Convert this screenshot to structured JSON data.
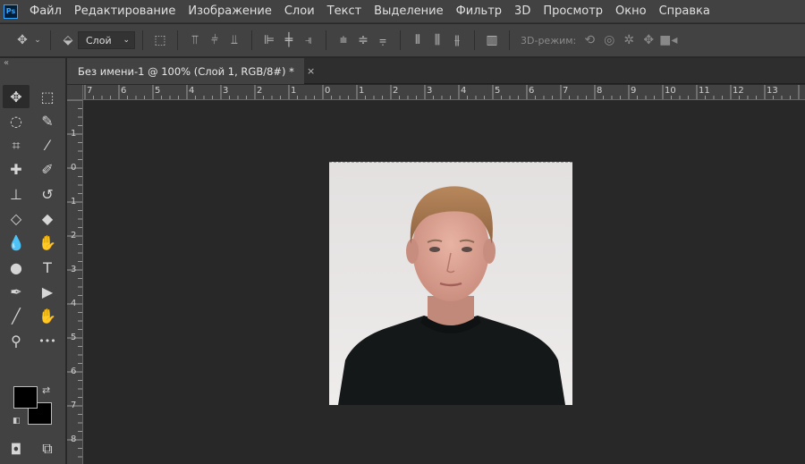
{
  "app": {
    "logo_text": "Ps"
  },
  "menu": [
    "Файл",
    "Редактирование",
    "Изображение",
    "Слои",
    "Текст",
    "Выделение",
    "Фильтр",
    "3D",
    "Просмотр",
    "Окно",
    "Справка"
  ],
  "options": {
    "auto_select_value": "Слой",
    "mode_3d_label": "3D-режим:"
  },
  "document": {
    "tab_title": "Без имени-1 @ 100% (Слой 1, RGB/8#) *",
    "close_glyph": "×"
  },
  "ruler_top_labels": [
    "7",
    "6",
    "5",
    "4",
    "3",
    "2",
    "1",
    "0",
    "1",
    "2",
    "3",
    "4",
    "5",
    "6",
    "7",
    "8",
    "9",
    "10",
    "11",
    "12",
    "13"
  ],
  "ruler_left_labels": [
    "1",
    "0",
    "1",
    "2",
    "3",
    "4",
    "5",
    "6",
    "7",
    "8"
  ],
  "tools": [
    {
      "name": "move-tool-icon",
      "glyph": "✥"
    },
    {
      "name": "marquee-tool-icon",
      "glyph": "⬚"
    },
    {
      "name": "lasso-tool-icon",
      "glyph": "◌"
    },
    {
      "name": "quick-selection-tool-icon",
      "glyph": "✎"
    },
    {
      "name": "crop-tool-icon",
      "glyph": "⌗"
    },
    {
      "name": "eyedropper-tool-icon",
      "glyph": "⁄"
    },
    {
      "name": "healing-brush-tool-icon",
      "glyph": "✚"
    },
    {
      "name": "brush-tool-icon",
      "glyph": "✐"
    },
    {
      "name": "clone-stamp-tool-icon",
      "glyph": "⊥"
    },
    {
      "name": "history-brush-tool-icon",
      "glyph": "↺"
    },
    {
      "name": "eraser-tool-icon",
      "glyph": "◇"
    },
    {
      "name": "paint-bucket-tool-icon",
      "glyph": "◆"
    },
    {
      "name": "blur-tool-icon",
      "glyph": "💧"
    },
    {
      "name": "smudge-tool-icon",
      "glyph": "✋"
    },
    {
      "name": "dodge-tool-icon",
      "glyph": "●"
    },
    {
      "name": "type-tool-icon",
      "glyph": "T"
    },
    {
      "name": "pen-tool-icon",
      "glyph": "✒"
    },
    {
      "name": "path-selection-tool-icon",
      "glyph": "▶"
    },
    {
      "name": "line-tool-icon",
      "glyph": "╱"
    },
    {
      "name": "hand-tool-icon",
      "glyph": "✋"
    },
    {
      "name": "zoom-tool-icon",
      "glyph": "⚲"
    },
    {
      "name": "more-tools-icon",
      "glyph": "•••"
    },
    {
      "name": "quick-mask-icon",
      "glyph": "◘"
    },
    {
      "name": "screen-mode-icon",
      "glyph": "⧉"
    }
  ]
}
